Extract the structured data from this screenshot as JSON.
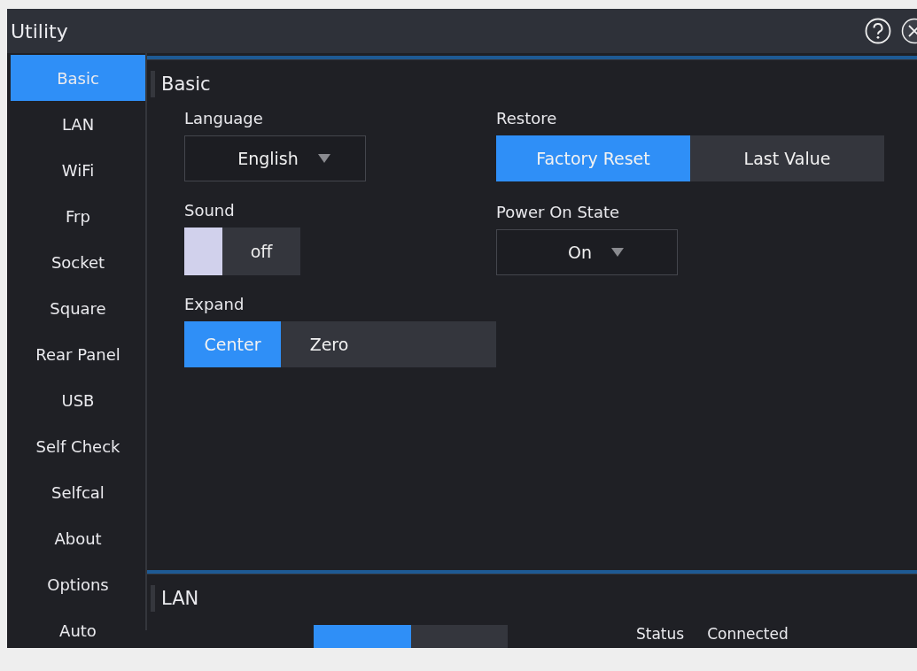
{
  "window": {
    "title": "Utility"
  },
  "sidebar": {
    "items": [
      {
        "label": "Basic",
        "selected": true
      },
      {
        "label": "LAN",
        "selected": false
      },
      {
        "label": "WiFi",
        "selected": false
      },
      {
        "label": "Frp",
        "selected": false
      },
      {
        "label": "Socket",
        "selected": false
      },
      {
        "label": "Square",
        "selected": false
      },
      {
        "label": "Rear Panel",
        "selected": false
      },
      {
        "label": "USB",
        "selected": false
      },
      {
        "label": "Self Check",
        "selected": false
      },
      {
        "label": "Selfcal",
        "selected": false
      },
      {
        "label": "About",
        "selected": false
      },
      {
        "label": "Options",
        "selected": false
      },
      {
        "label": "Auto",
        "selected": false
      }
    ]
  },
  "basic": {
    "title": "Basic",
    "left": [
      {
        "kind": "dropdown",
        "label": "Language",
        "value": "English"
      },
      {
        "kind": "toggle",
        "label": "Sound",
        "on": false,
        "text": "off"
      },
      {
        "kind": "segmented",
        "label": "Expand",
        "options": [
          {
            "label": "Center",
            "selected": true
          },
          {
            "label": "Zero",
            "selected": false
          }
        ]
      }
    ],
    "right": [
      {
        "kind": "segmented",
        "label": "Restore",
        "options": [
          {
            "label": "Factory Reset",
            "selected": true
          },
          {
            "label": "Last Value",
            "selected": false
          }
        ]
      },
      {
        "kind": "dropdown",
        "label": "Power On State",
        "value": "On"
      }
    ]
  },
  "lan": {
    "title": "LAN",
    "switch": {
      "on": true
    },
    "status_label": "Status",
    "status_value": "Connected"
  }
}
